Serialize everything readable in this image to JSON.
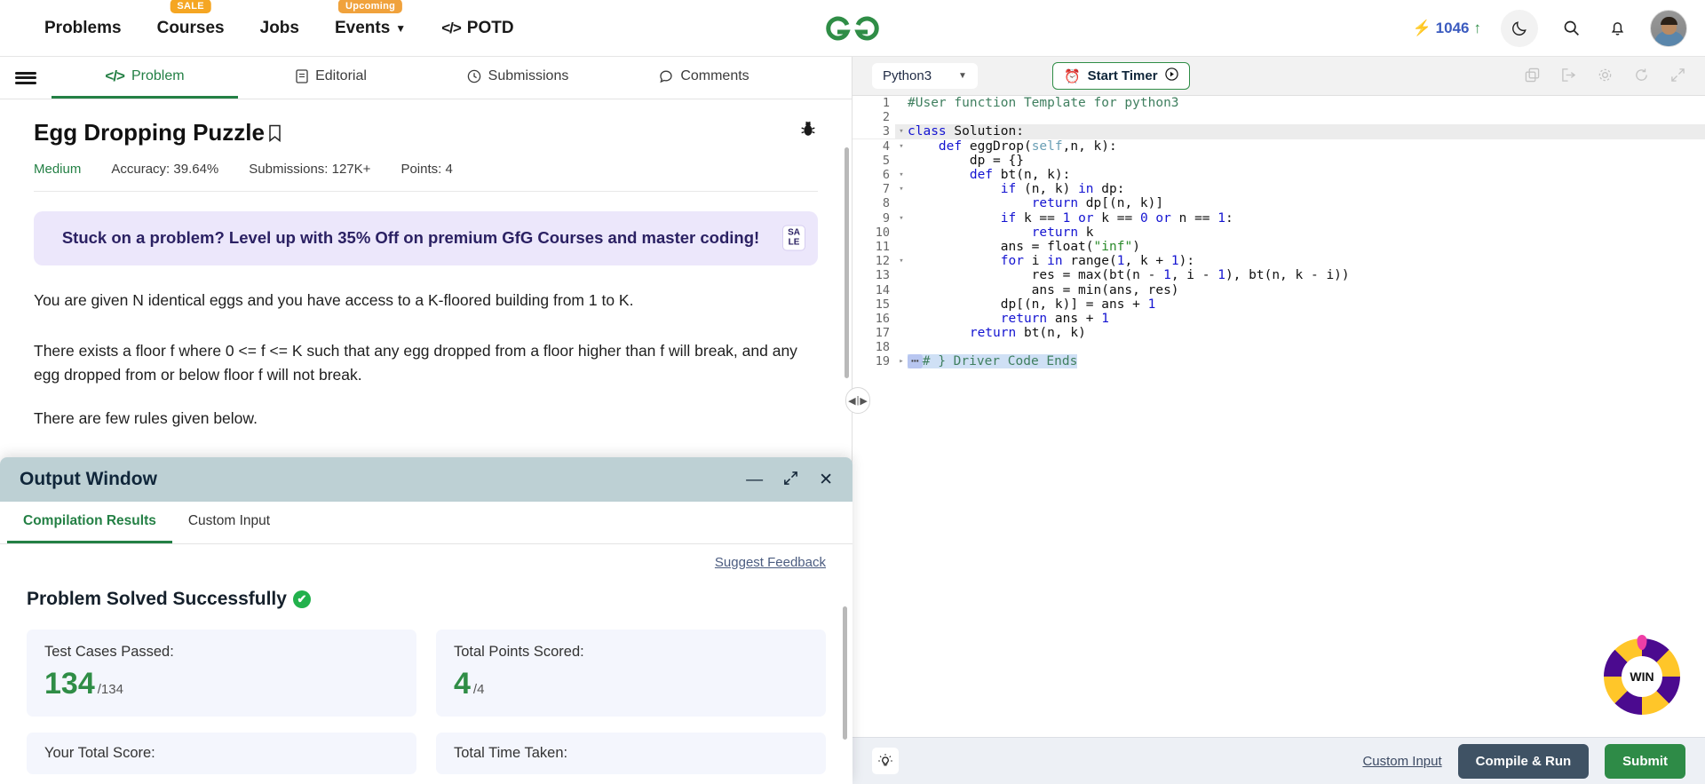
{
  "topnav": {
    "items": [
      {
        "label": "Problems",
        "badge": null,
        "caret": false
      },
      {
        "label": "Courses",
        "badge": "SALE",
        "caret": false
      },
      {
        "label": "Jobs",
        "badge": null,
        "caret": false
      },
      {
        "label": "Events",
        "badge": "Upcoming",
        "caret": true
      }
    ],
    "potd_label": "POTD",
    "potd_glyph": "</>",
    "logo_alt": "geeksforgeeks-logo",
    "score": "1046",
    "bolt_icon": "lightning-bolt-icon",
    "up_icon": "↑",
    "moon_icon": "☾",
    "search_icon": "search-icon",
    "bell_icon": "bell-icon",
    "avatar_alt": "user-avatar"
  },
  "left": {
    "tabs": [
      {
        "label": "Problem",
        "icon": "</>",
        "active": true
      },
      {
        "label": "Editorial",
        "icon": "document-icon",
        "active": false
      },
      {
        "label": "Submissions",
        "icon": "clock-icon",
        "active": false
      },
      {
        "label": "Comments",
        "icon": "comment-icon",
        "active": false
      }
    ],
    "title": "Egg Dropping Puzzle",
    "bookmark_icon": "bookmark-icon",
    "bug_icon": "bug-icon",
    "meta": {
      "difficulty": "Medium",
      "accuracy": "Accuracy: 39.64%",
      "submissions": "Submissions: 127K+",
      "points": "Points: 4"
    },
    "promo": {
      "text": "Stuck on a problem? Level up with 35% Off on premium GfG Courses and master coding!",
      "badge_line1": "SA",
      "badge_line2": "LE"
    },
    "paragraphs": [
      "You are given N identical eggs and you have access to a K-floored building from 1 to K.",
      "There exists a floor f where 0 <= f <= K such that any egg dropped from a floor higher than f will break, and any egg dropped from or below floor f will not break.",
      "There are few rules given below."
    ]
  },
  "output_window": {
    "title": "Output Window",
    "minimize_icon": "minimize-icon",
    "expand_icon": "expand-icon",
    "close_icon": "close-icon",
    "tabs": [
      {
        "label": "Compilation Results",
        "active": true
      },
      {
        "label": "Custom Input",
        "active": false
      }
    ],
    "feedback_link": "Suggest Feedback",
    "status": "Problem Solved Successfully",
    "status_check": "✔",
    "cards": [
      {
        "label": "Test Cases Passed:",
        "value": "134",
        "sub": "/134"
      },
      {
        "label": "Total Points Scored:",
        "value": "4",
        "sub": "/4"
      },
      {
        "label": "Your Total Score:",
        "value": "",
        "sub": ""
      },
      {
        "label": "Total Time Taken:",
        "value": "",
        "sub": ""
      }
    ]
  },
  "editor": {
    "language": "Python3",
    "caret_icon": "chevron-down-icon",
    "timer_label": "Start Timer",
    "timer_clock_icon": "alarm-clock-icon",
    "timer_play_icon": "▶",
    "tools": [
      {
        "name": "copy-icon",
        "glyph": "❐"
      },
      {
        "name": "import-icon",
        "glyph": "↱"
      },
      {
        "name": "settings-gear-icon",
        "glyph": "⚙"
      },
      {
        "name": "reset-icon",
        "glyph": "⟳"
      },
      {
        "name": "fullscreen-icon",
        "glyph": "⤢"
      }
    ],
    "lines": [
      {
        "n": "1",
        "fold": "",
        "html": "<span class='cm'>#User function Template for python3</span>"
      },
      {
        "n": "2",
        "fold": "",
        "html": ""
      },
      {
        "n": "3",
        "fold": "▾",
        "html": "<span class='kw'>class</span> Solution:",
        "hl": true
      },
      {
        "n": "4",
        "fold": "▾",
        "html": "    <span class='kw'>def</span> eggDrop(<span class='self'>self</span>,n, k):"
      },
      {
        "n": "5",
        "fold": "",
        "html": "        dp = {}"
      },
      {
        "n": "6",
        "fold": "▾",
        "html": "        <span class='kw'>def</span> bt(n, k):"
      },
      {
        "n": "7",
        "fold": "▾",
        "html": "            <span class='kw'>if</span> (n, k) <span class='kw'>in</span> dp:"
      },
      {
        "n": "8",
        "fold": "",
        "html": "                <span class='kw'>return</span> dp[(n, k)]"
      },
      {
        "n": "9",
        "fold": "▾",
        "html": "            <span class='kw'>if</span> k == <span class='num'>1</span> <span class='kw'>or</span> k == <span class='num'>0</span> <span class='kw'>or</span> n == <span class='num'>1</span>:"
      },
      {
        "n": "10",
        "fold": "",
        "html": "                <span class='kw'>return</span> k"
      },
      {
        "n": "11",
        "fold": "",
        "html": "            ans = <span class='fn'>float</span>(<span class='str'>\"inf\"</span>)"
      },
      {
        "n": "12",
        "fold": "▾",
        "html": "            <span class='kw'>for</span> i <span class='kw'>in</span> range(<span class='num'>1</span>, k + <span class='num'>1</span>):"
      },
      {
        "n": "13",
        "fold": "",
        "html": "                res = max(bt(n - <span class='num'>1</span>, i - <span class='num'>1</span>), bt(n, k - i))"
      },
      {
        "n": "14",
        "fold": "",
        "html": "                ans = min(ans, res)"
      },
      {
        "n": "15",
        "fold": "",
        "html": "            dp[(n, k)] = ans + <span class='num'>1</span>"
      },
      {
        "n": "16",
        "fold": "",
        "html": "            <span class='kw'>return</span> ans + <span class='num'>1</span>"
      },
      {
        "n": "17",
        "fold": "",
        "html": "        <span class='kw'>return</span> bt(n, k)"
      },
      {
        "n": "18",
        "fold": "",
        "html": ""
      },
      {
        "n": "19",
        "fold": "▸",
        "html": "<span class='folded-line'><span class='folded'>⋯</span><span class='cm'># } Driver Code Ends</span></span>"
      }
    ]
  },
  "wheel": {
    "label": "WIN"
  },
  "actionbar": {
    "bulb_icon": "lightbulb-icon",
    "custom_input": "Custom Input",
    "compile_run": "Compile & Run",
    "submit": "Submit"
  },
  "colors": {
    "brand_green": "#2f8d46",
    "accent_orange": "#f5a623",
    "promo_bg": "#ece7fb",
    "outwin_header": "#bdd0d4",
    "submit_green": "#2e8b47",
    "compile_dark": "#3f5264"
  }
}
